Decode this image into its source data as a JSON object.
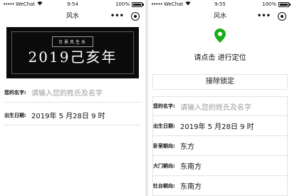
{
  "left": {
    "status": {
      "signal": "•••••",
      "carrier": "WeChat",
      "time": "9:54",
      "battery_pct": "100%",
      "battery_level": 1.0
    },
    "nav": {
      "title": "风水",
      "more": "•••"
    },
    "banner": {
      "subtitle": "日景风生水",
      "year": "2019己亥年"
    },
    "rows": [
      {
        "label": "您的名字:",
        "placeholder": "请输入您的姓氏及名字"
      },
      {
        "label": "出生日期:",
        "value": "2019年 5 月28日 9 时"
      }
    ]
  },
  "right": {
    "status": {
      "signal": "•••••",
      "carrier": "WeChat",
      "time": "9:55",
      "battery_pct": "100%",
      "battery_level": 1.0
    },
    "nav": {
      "title": "风水",
      "more": "•••"
    },
    "locate_text": "请点击 进行定位",
    "unlock_label": "接除锁定",
    "rows": [
      {
        "label": "您的名字:",
        "placeholder": "请输入您的姓氏及名字"
      },
      {
        "label": "出生日期:",
        "value": "2019年 5 月28日 9 时"
      },
      {
        "label": "卧室朝向:",
        "value": "东方"
      },
      {
        "label": "大门朝向:",
        "value": "东南方"
      },
      {
        "label": "灶台朝向:",
        "value": "东南方"
      }
    ]
  },
  "colors": {
    "pin": "#1aad19",
    "banner_bg": "#0b0b0b",
    "placeholder": "#9a9a9a"
  },
  "icons": {
    "target": "target-icon",
    "pin": "location-pin-icon",
    "wifi": "wifi-icon",
    "battery": "battery-icon"
  }
}
